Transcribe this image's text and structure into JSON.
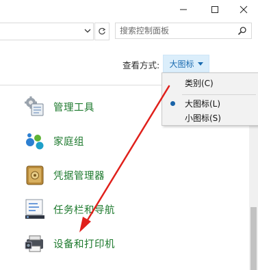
{
  "window": {
    "minimize_glyph": "—",
    "maximize_glyph": "☐",
    "close_glyph": "✕"
  },
  "address": {
    "dropdown_icon": "chevron-down-icon",
    "refresh_icon": "refresh-icon"
  },
  "search": {
    "placeholder": "搜索控制面板",
    "icon": "search-icon"
  },
  "view_by": {
    "label": "查看方式:",
    "selected": "大图标"
  },
  "view_menu": {
    "options": [
      "类别(C)",
      "大图标(L)",
      "小图标(S)"
    ],
    "checked": "大图标(L)"
  },
  "items": [
    {
      "label": "管理工具",
      "icon": "admin-tools-icon"
    },
    {
      "label": "家庭组",
      "icon": "homegroup-icon"
    },
    {
      "label": "凭据管理器",
      "icon": "credential-manager-icon"
    },
    {
      "label": "任务栏和导航",
      "icon": "taskbar-navigation-icon"
    },
    {
      "label": "设备和打印机",
      "icon": "devices-printers-icon"
    }
  ],
  "colors": {
    "link_green": "#1e7a2e",
    "accent_blue": "#1a6bb0",
    "annotation_red": "#e0201b"
  }
}
